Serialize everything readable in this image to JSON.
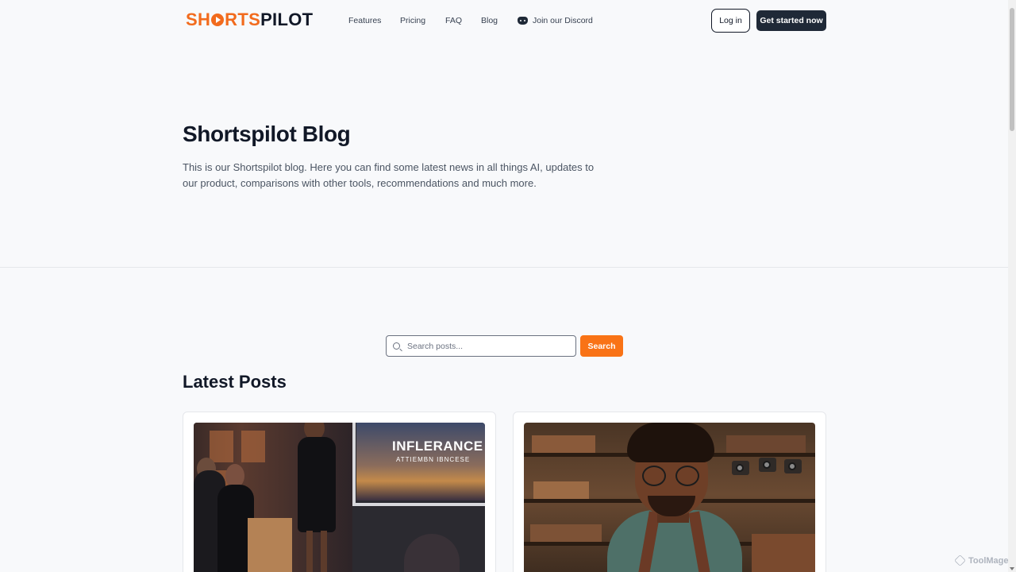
{
  "brand": {
    "part_a_prefix": "SH",
    "part_a_suffix": "RTS",
    "part_b": "PILOT",
    "accent": "#f97316",
    "dark": "#1f2937"
  },
  "nav": {
    "items": [
      {
        "label": "Features"
      },
      {
        "label": "Pricing"
      },
      {
        "label": "FAQ"
      },
      {
        "label": "Blog"
      },
      {
        "label": "Join our Discord",
        "icon": "discord-icon"
      }
    ],
    "login_label": "Log in",
    "cta_label": "Get started now"
  },
  "hero": {
    "title": "Shortspilot Blog",
    "description": "This is our Shortspilot blog. Here you can find some latest news in all things AI, updates to our product, comparisons with other tools, recommendations and much more."
  },
  "search": {
    "placeholder": "Search posts...",
    "value": "",
    "button_label": "Search",
    "icon": "search-icon"
  },
  "latest": {
    "title": "Latest Posts",
    "posts": [
      {
        "image_text_line1": "INFLERANCE",
        "image_text_line2": "ATTIEMBN IBNCESE"
      },
      {}
    ]
  },
  "watermark": "ToolMage"
}
